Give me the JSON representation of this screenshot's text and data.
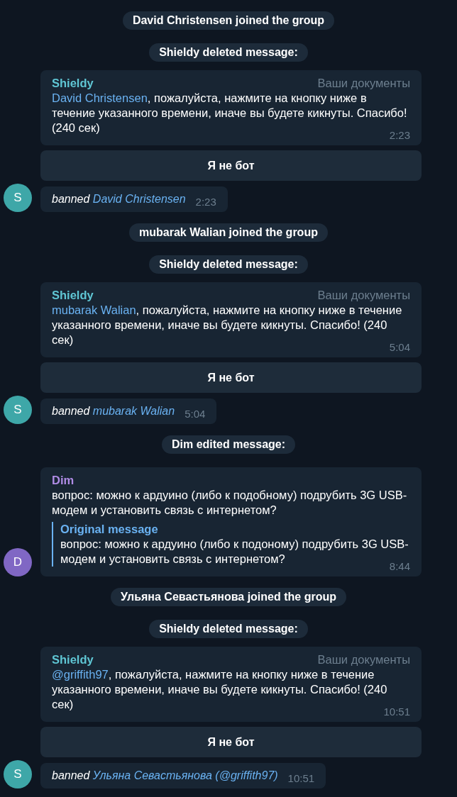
{
  "messages": [
    {
      "kind": "service",
      "text": "David Christensen joined the group"
    },
    {
      "kind": "service",
      "text": "Shieldy deleted message:"
    },
    {
      "kind": "bot",
      "sender": {
        "name": "Shieldy",
        "color": "#5fc6d4"
      },
      "tag": "Ваши документы",
      "mention": "David Christensen",
      "text": ", пожалуйста, нажмите на кнопку ниже в течение указанного времени, иначе вы будете кикнуты. Спасибо! (240 сек)",
      "time": "2:23",
      "button": "Я не бот"
    },
    {
      "kind": "banned",
      "avatar": {
        "letter": "S",
        "color": "#3ea7a8"
      },
      "action": "banned",
      "target": "David Christensen",
      "time": "2:23"
    },
    {
      "kind": "service",
      "text": "mubarak Walian joined the group"
    },
    {
      "kind": "service",
      "text": "Shieldy deleted message:"
    },
    {
      "kind": "bot",
      "sender": {
        "name": "Shieldy",
        "color": "#5fc6d4"
      },
      "tag": "Ваши документы",
      "mention": "mubarak Walian",
      "text": ", пожалуйста, нажмите на кнопку ниже в течение указанного времени, иначе вы будете кикнуты. Спасибо! (240 сек)",
      "time": "5:04",
      "button": "Я не бот"
    },
    {
      "kind": "banned",
      "avatar": {
        "letter": "S",
        "color": "#3ea7a8"
      },
      "action": "banned",
      "target": "mubarak Walian",
      "time": "5:04"
    },
    {
      "kind": "service",
      "text": "Dim edited message:"
    },
    {
      "kind": "edited",
      "avatar": {
        "letter": "D",
        "color": "#8067c4"
      },
      "sender": {
        "name": "Dim",
        "color": "#b08ce6"
      },
      "text": "вопрос: можно к ардуино (либо к подобному) подрубить 3G USB-модем и установить связь с интернетом?",
      "quote_title": "Original message",
      "quote_text": "вопрос: можно к ардуино (либо к подоному) подрубить 3G USB-модем и установить связь с интернетом?",
      "time": "8:44"
    },
    {
      "kind": "service",
      "text": "Ульяна Севастьянова joined the group"
    },
    {
      "kind": "service",
      "text": "Shieldy deleted message:"
    },
    {
      "kind": "bot",
      "sender": {
        "name": "Shieldy",
        "color": "#5fc6d4"
      },
      "tag": "Ваши документы",
      "mention": "@griffith97",
      "text": ", пожалуйста, нажмите на кнопку ниже в течение указанного времени, иначе вы будете кикнуты. Спасибо! (240 сек)",
      "time": "10:51",
      "button": "Я не бот"
    },
    {
      "kind": "banned",
      "avatar": {
        "letter": "S",
        "color": "#3ea7a8"
      },
      "action": "banned",
      "target": "Ульяна Севастьянова (@griffith97)",
      "time": "10:51"
    }
  ]
}
